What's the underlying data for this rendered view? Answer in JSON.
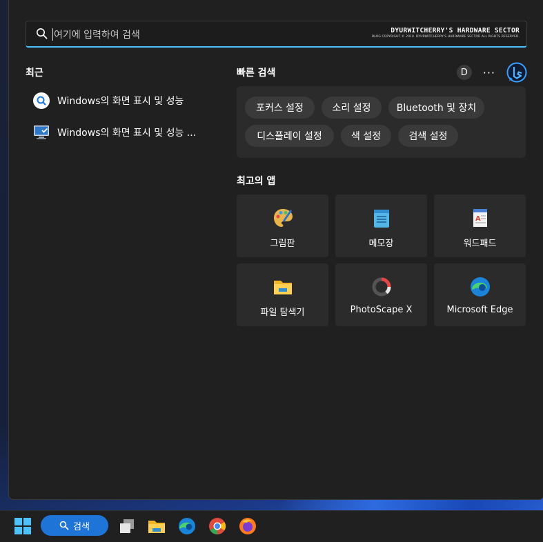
{
  "search": {
    "placeholder": "여기에 입력하여 검색",
    "brand_title": "DYURWITCHERRY'S HARDWARE SECTOR",
    "brand_sub": "BLOG COPYRIGHT © 2010. DYURWITCHERRY'S HARDWARE SECTOR ALL RIGHTS RESERVED."
  },
  "recent": {
    "title": "최근",
    "items": [
      {
        "label": "Windows의 화면 표시 및 성능",
        "icon": "search-icon"
      },
      {
        "label": "Windows의 화면 표시 및 성능 ...",
        "icon": "monitor-settings-icon"
      }
    ]
  },
  "quick": {
    "title": "빠른 검색",
    "avatar": "D",
    "more": "···",
    "chips": [
      "포커스 설정",
      "소리 설정",
      "Bluetooth 및 장치",
      "디스플레이 설정",
      "색 설정",
      "검색 설정"
    ]
  },
  "apps": {
    "title": "최고의 앱",
    "items": [
      {
        "label": "그림판",
        "icon": "paint-icon"
      },
      {
        "label": "메모장",
        "icon": "notepad-icon"
      },
      {
        "label": "워드패드",
        "icon": "wordpad-icon"
      },
      {
        "label": "파일 탐색기",
        "icon": "file-explorer-icon"
      },
      {
        "label": "PhotoScape X",
        "icon": "photoscape-icon"
      },
      {
        "label": "Microsoft Edge",
        "icon": "edge-icon"
      }
    ]
  },
  "taskbar": {
    "search_label": "검색"
  },
  "colors": {
    "accent": "#4cc2ff",
    "panel": "#202020",
    "tile": "#2b2b2b",
    "taskbar_search": "#1e74d7"
  }
}
